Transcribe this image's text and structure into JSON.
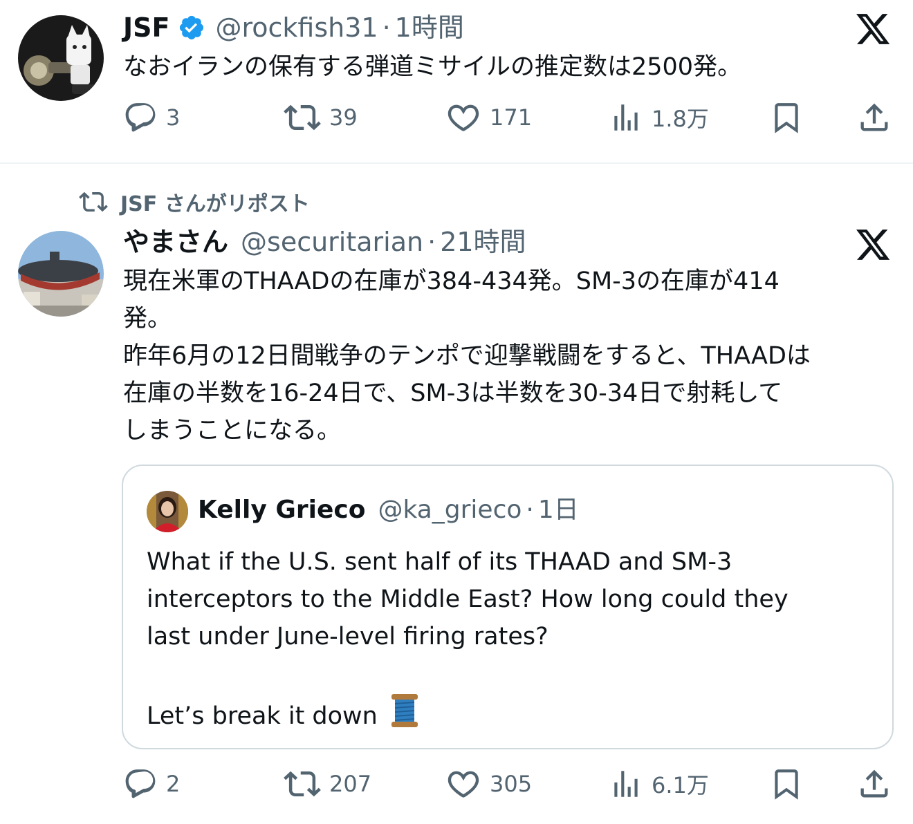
{
  "tweet1": {
    "name": "JSF",
    "handle": "@rockfish31",
    "sep": "·",
    "time": "1時間",
    "text": "なおイランの保有する弾道ミサイルの推定数は2500発。",
    "replies": "3",
    "reposts": "39",
    "likes": "171",
    "views": "1.8万"
  },
  "repost_notice": "JSF さんがリポスト",
  "tweet2": {
    "name": "やまさん",
    "handle": "@securitarian",
    "sep": "·",
    "time": "21時間",
    "lines": [
      "現在米軍のTHAADの在庫が384-434発。SM-3の在庫が414",
      "発。",
      "昨年6月の12日間戦争のテンポで迎撃戦闘をすると、THAADは",
      "在庫の半数を16-24日で、SM-3は半数を30-34日で射耗して",
      "しまうことになる。"
    ],
    "quote": {
      "name": "Kelly Grieco",
      "handle": "@ka_grieco",
      "sep": "·",
      "time": "1日",
      "lines": [
        "What if the U.S. sent half of its THAAD and SM-3",
        "interceptors to the Middle East? How long could they",
        "last under June-level firing rates?",
        "Let’s break it down"
      ]
    },
    "replies": "2",
    "reposts": "207",
    "likes": "305",
    "views": "6.1万"
  },
  "icons": {
    "verified": "verified-badge-icon",
    "x_logo": "x-logo-icon",
    "reply": "reply-icon",
    "repost": "repost-icon",
    "like": "heart-icon",
    "views": "views-icon",
    "bookmark": "bookmark-icon",
    "share": "share-icon",
    "spool": "thread-spool-emoji"
  },
  "colors": {
    "text": "#0f1419",
    "secondary": "#536471",
    "verified": "#1d9bf0",
    "border": "#cfd9de"
  }
}
